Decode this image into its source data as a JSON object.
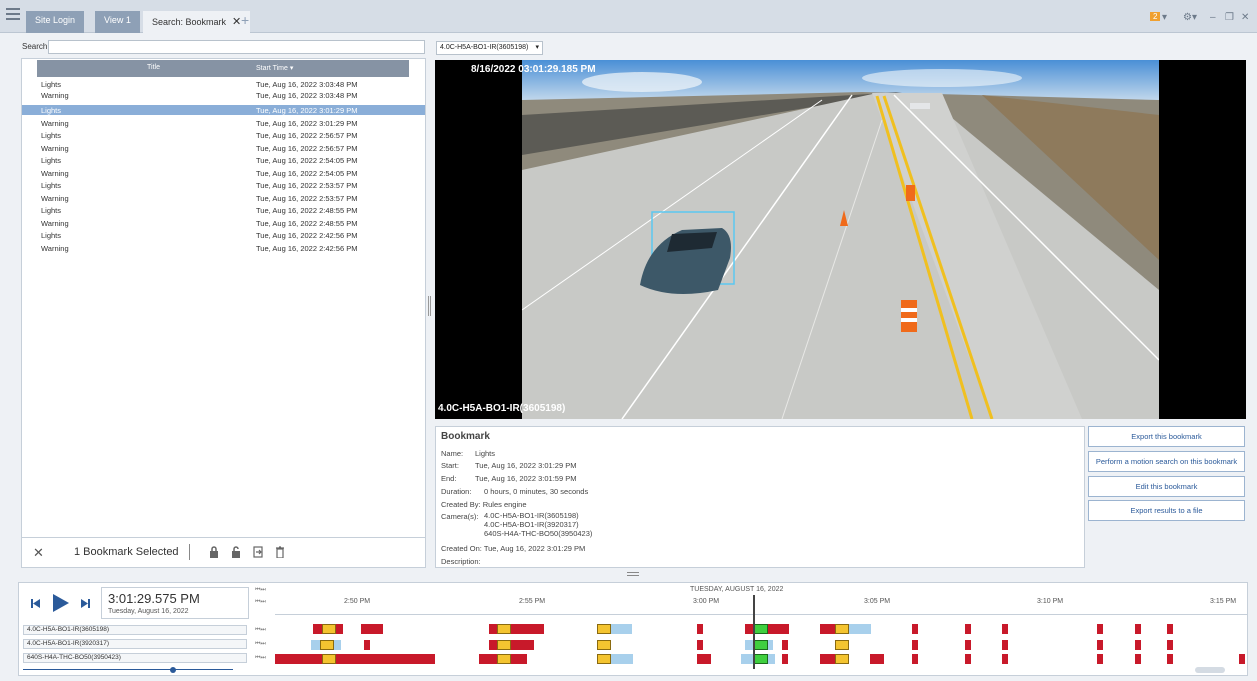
{
  "titlebar": {
    "tabs": [
      {
        "label": "Site Login"
      },
      {
        "label": "View 1"
      },
      {
        "label": "Search: Bookmark"
      }
    ],
    "notification_count": "2"
  },
  "search": {
    "label": "Search:",
    "value": ""
  },
  "list": {
    "columns": [
      "Title",
      "Start Time ▾"
    ],
    "rows": [
      {
        "title": "Lights",
        "start": "Tue, Aug 16, 2022 3:03:48 PM"
      },
      {
        "title": "Warning",
        "start": "Tue, Aug 16, 2022 3:03:48 PM"
      },
      {
        "title": "Lights",
        "start": "Tue, Aug 16, 2022 3:01:29 PM"
      },
      {
        "title": "Warning",
        "start": "Tue, Aug 16, 2022 3:01:29 PM"
      },
      {
        "title": "Lights",
        "start": "Tue, Aug 16, 2022 2:56:57 PM"
      },
      {
        "title": "Warning",
        "start": "Tue, Aug 16, 2022 2:56:57 PM"
      },
      {
        "title": "Lights",
        "start": "Tue, Aug 16, 2022 2:54:05 PM"
      },
      {
        "title": "Warning",
        "start": "Tue, Aug 16, 2022 2:54:05 PM"
      },
      {
        "title": "Lights",
        "start": "Tue, Aug 16, 2022 2:53:57 PM"
      },
      {
        "title": "Warning",
        "start": "Tue, Aug 16, 2022 2:53:57 PM"
      },
      {
        "title": "Lights",
        "start": "Tue, Aug 16, 2022 2:48:55 PM"
      },
      {
        "title": "Warning",
        "start": "Tue, Aug 16, 2022 2:48:55 PM"
      },
      {
        "title": "Lights",
        "start": "Tue, Aug 16, 2022 2:42:56 PM"
      },
      {
        "title": "Warning",
        "start": "Tue, Aug 16, 2022 2:42:56 PM"
      }
    ],
    "selected_index": 2
  },
  "bottombar": {
    "selected_text": "1 Bookmark Selected"
  },
  "camera_select": {
    "value": "4.0C-H5A-BO1-IR(3605198)"
  },
  "video": {
    "timestamp": "8/16/2022 03:01:29.185 PM",
    "camera_label": "4.0C-H5A-BO1-IR(3605198)"
  },
  "bookmark": {
    "heading": "Bookmark",
    "name_label": "Name:",
    "name": "Lights",
    "start_label": "Start:",
    "start": "Tue, Aug 16, 2022 3:01:29 PM",
    "end_label": "End:",
    "end": "Tue, Aug 16, 2022 3:01:59 PM",
    "duration_label": "Duration:",
    "duration": "0 hours, 0 minutes, 30 seconds",
    "created_by_label": "Created By:",
    "created_by": "Rules engine",
    "cameras_label": "Camera(s):",
    "cameras": [
      "4.0C-H5A-BO1-IR(3605198)",
      "4.0C-H5A-BO1-IR(3920317)",
      "640S-H4A-THC-BO50(3950423)"
    ],
    "created_on_label": "Created On:",
    "created_on": "Tue, Aug 16, 2022 3:01:29 PM",
    "description_label": "Description:"
  },
  "actions": {
    "export": "Export this bookmark",
    "motion_search": "Perform a motion search on this bookmark",
    "edit": "Edit this bookmark",
    "export_results": "Export results to a file"
  },
  "timeline": {
    "current_time": "3:01:29.575 PM",
    "current_date": "Tuesday, August 16, 2022",
    "date_header": "TUESDAY, AUGUST 16, 2022",
    "ticks": [
      "2:50 PM",
      "2:55 PM",
      "3:00 PM",
      "3:05 PM",
      "3:10 PM",
      "3:15 PM"
    ],
    "cameras": [
      "4.0C-H5A-BO1-IR(3605198)",
      "4.0C-H5A-BO1-IR(3920317)",
      "640S-H4A-THC-BO50(3950423)"
    ]
  },
  "colors": {
    "accent": "#2b5a9a",
    "selected_row": "#8aaed8",
    "motion_event": "#c8192a",
    "bookmark_event": "#f4c430",
    "current_event": "#3fcf3f"
  }
}
